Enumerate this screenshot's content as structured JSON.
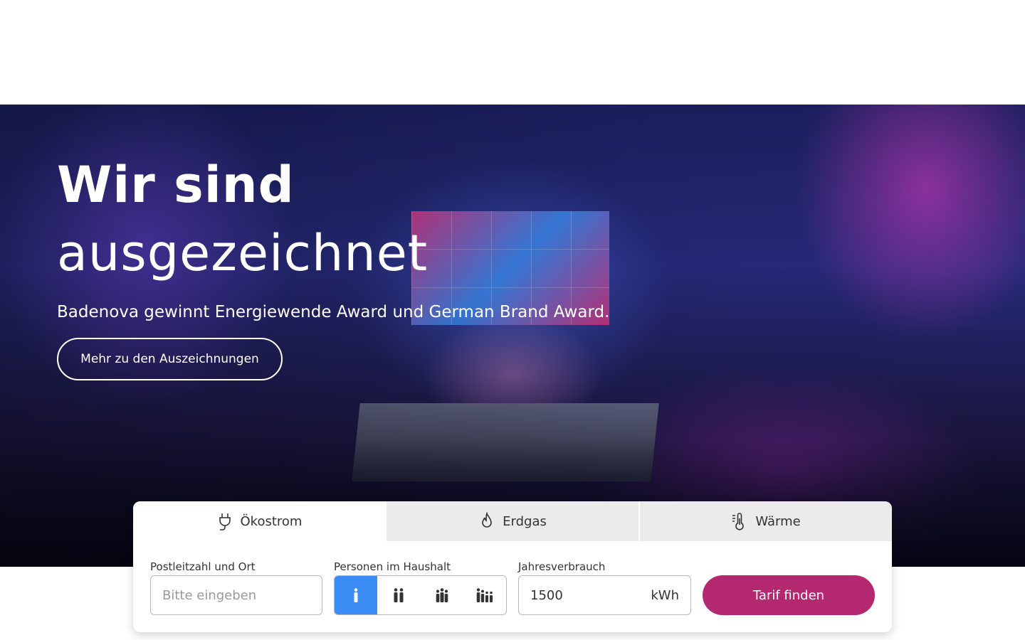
{
  "hero": {
    "title_bold": "Wir sind",
    "title_light": "ausgezeichnet",
    "subtitle": "Badenova gewinnt Energiewende Award und German Brand Award.",
    "cta_label": "Mehr zu den Auszeichnungen"
  },
  "calculator": {
    "tabs": [
      {
        "label": "Ökostrom",
        "icon": "plug-icon",
        "active": true
      },
      {
        "label": "Erdgas",
        "icon": "flame-icon",
        "active": false
      },
      {
        "label": "Wärme",
        "icon": "thermometer-icon",
        "active": false
      }
    ],
    "plz": {
      "label": "Postleitzahl und Ort",
      "placeholder": "Bitte eingeben",
      "value": ""
    },
    "persons": {
      "label": "Personen im Haushalt",
      "options": [
        1,
        2,
        3,
        4
      ],
      "selected": 1
    },
    "consumption": {
      "label": "Jahresverbrauch",
      "value": "1500",
      "unit": "kWh"
    },
    "submit_label": "Tarif finden"
  },
  "colors": {
    "accent": "#b3286f",
    "selected": "#3b8df5",
    "tab_inactive": "#ebebeb"
  }
}
